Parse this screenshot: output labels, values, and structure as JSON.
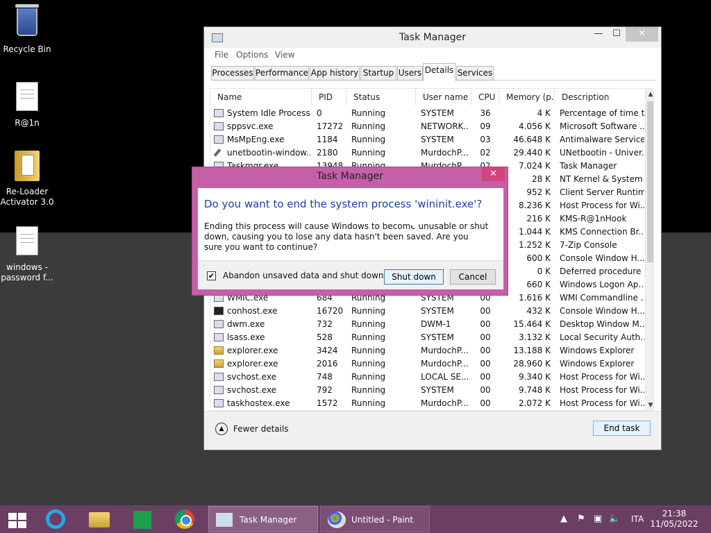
{
  "desktop": {
    "icons": [
      {
        "label": "Recycle Bin",
        "icon": "recycle-bin-icon"
      },
      {
        "label": "R@1n",
        "icon": "document-icon"
      },
      {
        "label": "Re-Loader Activator 3.0",
        "icon": "folder-icon"
      },
      {
        "label": "windows - password f...",
        "icon": "document-icon"
      }
    ]
  },
  "task_manager": {
    "title": "Task Manager",
    "window_buttons": {
      "minimize": "—",
      "maximize": "☐",
      "close": "✕"
    },
    "menu": [
      "File",
      "Options",
      "View"
    ],
    "tabs": [
      {
        "label": "Processes",
        "active": false
      },
      {
        "label": "Performance",
        "active": false
      },
      {
        "label": "App history",
        "active": false
      },
      {
        "label": "Startup",
        "active": false
      },
      {
        "label": "Users",
        "active": false
      },
      {
        "label": "Details",
        "active": true
      },
      {
        "label": "Services",
        "active": false
      }
    ],
    "columns": [
      "Name",
      "PID",
      "Status",
      "User name",
      "CPU",
      "Memory (p...",
      "Description"
    ],
    "rows": [
      {
        "name": "System Idle Process",
        "pid": "0",
        "status": "Running",
        "user": "SYSTEM",
        "cpu": "36",
        "mem": "4 K",
        "desc": "Percentage of time t...",
        "icon": "window"
      },
      {
        "name": "sppsvc.exe",
        "pid": "17272",
        "status": "Running",
        "user": "NETWORK...",
        "cpu": "09",
        "mem": "4.056 K",
        "desc": "Microsoft Software ...",
        "icon": "window"
      },
      {
        "name": "MsMpEng.exe",
        "pid": "1184",
        "status": "Running",
        "user": "SYSTEM",
        "cpu": "03",
        "mem": "46.648 K",
        "desc": "Antimalware Service...",
        "icon": "window"
      },
      {
        "name": "unetbootin-window...",
        "pid": "2180",
        "status": "Running",
        "user": "MurdochP...",
        "cpu": "02",
        "mem": "29.440 K",
        "desc": "UNetbootin - Univer...",
        "icon": "tool"
      },
      {
        "name": "Taskmgr.exe",
        "pid": "13948",
        "status": "Running",
        "user": "MurdochP...",
        "cpu": "02",
        "mem": "7.024 K",
        "desc": "Task Manager",
        "icon": "window"
      },
      {
        "name": "",
        "pid": "",
        "status": "",
        "user": "",
        "cpu": "",
        "mem": "28 K",
        "desc": "NT Kernel & System",
        "icon": "window"
      },
      {
        "name": "",
        "pid": "",
        "status": "",
        "user": "",
        "cpu": "",
        "mem": "952 K",
        "desc": "Client Server Runtim...",
        "icon": "window"
      },
      {
        "name": "",
        "pid": "",
        "status": "",
        "user": "",
        "cpu": "",
        "mem": "8.236 K",
        "desc": "Host Process for Wi...",
        "icon": "window"
      },
      {
        "name": "",
        "pid": "",
        "status": "",
        "user": "",
        "cpu": "",
        "mem": "216 K",
        "desc": "KMS-R@1nHook",
        "icon": "window"
      },
      {
        "name": "",
        "pid": "",
        "status": "",
        "user": "",
        "cpu": "",
        "mem": "1.044 K",
        "desc": "KMS Connection Br...",
        "icon": "window"
      },
      {
        "name": "",
        "pid": "",
        "status": "",
        "user": "",
        "cpu": "",
        "mem": "1.252 K",
        "desc": "7-Zip Console",
        "icon": "window"
      },
      {
        "name": "",
        "pid": "",
        "status": "",
        "user": "",
        "cpu": "",
        "mem": "600 K",
        "desc": "Console Window H...",
        "icon": "window"
      },
      {
        "name": "",
        "pid": "",
        "status": "",
        "user": "",
        "cpu": "",
        "mem": "0 K",
        "desc": "Deferred procedure ...",
        "icon": "window"
      },
      {
        "name": "",
        "pid": "",
        "status": "",
        "user": "",
        "cpu": "",
        "mem": "660 K",
        "desc": "Windows Logon Ap...",
        "icon": "window"
      },
      {
        "name": "WMIC.exe",
        "pid": "684",
        "status": "Running",
        "user": "SYSTEM",
        "cpu": "00",
        "mem": "1.616 K",
        "desc": "WMI Commandline ...",
        "icon": "window"
      },
      {
        "name": "conhost.exe",
        "pid": "16720",
        "status": "Running",
        "user": "SYSTEM",
        "cpu": "00",
        "mem": "432 K",
        "desc": "Console Window H...",
        "icon": "console"
      },
      {
        "name": "dwm.exe",
        "pid": "732",
        "status": "Running",
        "user": "DWM-1",
        "cpu": "00",
        "mem": "15.464 K",
        "desc": "Desktop Window M...",
        "icon": "window"
      },
      {
        "name": "lsass.exe",
        "pid": "528",
        "status": "Running",
        "user": "SYSTEM",
        "cpu": "00",
        "mem": "3.132 K",
        "desc": "Local Security Auth...",
        "icon": "window"
      },
      {
        "name": "explorer.exe",
        "pid": "3424",
        "status": "Running",
        "user": "MurdochP...",
        "cpu": "00",
        "mem": "13.188 K",
        "desc": "Windows Explorer",
        "icon": "folder"
      },
      {
        "name": "explorer.exe",
        "pid": "2016",
        "status": "Running",
        "user": "MurdochP...",
        "cpu": "00",
        "mem": "28.960 K",
        "desc": "Windows Explorer",
        "icon": "folder"
      },
      {
        "name": "svchost.exe",
        "pid": "748",
        "status": "Running",
        "user": "LOCAL SE...",
        "cpu": "00",
        "mem": "9.340 K",
        "desc": "Host Process for Wi...",
        "icon": "window"
      },
      {
        "name": "svchost.exe",
        "pid": "792",
        "status": "Running",
        "user": "SYSTEM",
        "cpu": "00",
        "mem": "9.748 K",
        "desc": "Host Process for Wi...",
        "icon": "window"
      },
      {
        "name": "taskhostex.exe",
        "pid": "1572",
        "status": "Running",
        "user": "MurdochP...",
        "cpu": "00",
        "mem": "2.072 K",
        "desc": "Host Process for Wi...",
        "icon": "window"
      }
    ],
    "footer": {
      "fewer_details": "Fewer details",
      "end_task": "End task"
    }
  },
  "dialog": {
    "title": "Task Manager",
    "close": "✕",
    "heading": "Do you want to end the system process 'wininit.exe'?",
    "body": "Ending this process will cause Windows to become unusable or shut down, causing you to lose any data hasn't been saved. Are you sure you want to continue?",
    "checkbox_label": "Abandon unsaved data and shut down.",
    "checkbox_checked": true,
    "checkbox_mark": "✔",
    "shutdown_label": "Shut down",
    "cancel_label": "Cancel"
  },
  "taskbar": {
    "pinned": [
      "windows-start-icon",
      "internet-explorer-icon",
      "file-explorer-icon",
      "store-icon",
      "chrome-icon"
    ],
    "tasks": [
      {
        "label": "Task Manager",
        "active": true
      },
      {
        "label": "Untitled - Paint",
        "active": false
      }
    ],
    "tray": {
      "language": "ITA",
      "time": "21:38",
      "date": "11/05/2022"
    }
  }
}
